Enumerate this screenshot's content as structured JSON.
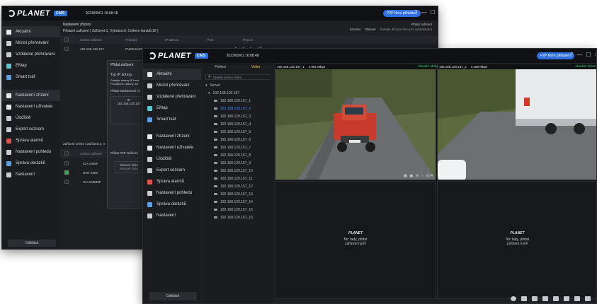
{
  "back_window": {
    "title_time": "2023/09/01 16:08:18",
    "p2p_label": "P2P Není přihlášen",
    "window_controls": [
      "?",
      "—",
      "☐",
      "✕"
    ],
    "nav": [
      {
        "label": "Aktuální",
        "icon": "camera-icon"
      },
      {
        "label": "Místní přehrávání",
        "icon": "list-icon"
      },
      {
        "label": "Vzdálené přehrávání",
        "icon": "wifi-icon"
      },
      {
        "label": "EMap",
        "icon": "map-icon"
      },
      {
        "label": "Smart tvář",
        "icon": "face-icon"
      },
      {
        "label": "Nastavení zřízení",
        "icon": "device-icon"
      },
      {
        "label": "Nastavení uživatele",
        "icon": "user-icon"
      },
      {
        "label": "Úložiště",
        "icon": "storage-icon"
      },
      {
        "label": "Export seznam",
        "icon": "export-icon"
      },
      {
        "label": "Správa alarmů",
        "icon": "alarm-icon"
      },
      {
        "label": "Nastavení pohledu",
        "icon": "view-icon"
      },
      {
        "label": "Správa obrázků",
        "icon": "image-icon"
      },
      {
        "label": "Nastavení",
        "icon": "settings-icon"
      }
    ],
    "logout_label": "Odhlásit",
    "content_title": "Nastavení zřízení",
    "added_devices": "Přidané zařízení  ( Zařízení:1, Vybráno:0, Celkem kanálů:16 )",
    "toolbar": {
      "delete": "Smazat",
      "refresh": "Obnovit",
      "add_device": "Přidat zařízení",
      "show_hint": "Zadejte díčova elmo pro vyhledávání"
    },
    "table_headers": [
      "Jméno zařízení",
      "Protokol",
      "IP adresa",
      "Port",
      "Provoz"
    ],
    "table_row": {
      "name": "192.168.120.157",
      "protocol": "PVMS,NVR",
      "ip": "192.168.120.157",
      "port": "80"
    },
    "dialog": {
      "title": "Přidat zařízení",
      "ip_type": "Typ IP adresy",
      "hint1": "Zadejte adresy IP hard",
      "hint2": "Použijeme zadaný adr",
      "hw_label": "Přidat hardwarové zř",
      "ip_col": "IP",
      "ip_val": "192.168.120.157",
      "p2p_label": "Přidat P2P zařízení",
      "serial": "Sériové číslo",
      "serial_sub": "Sériové číslo"
    },
    "online": {
      "header": "Zařízení online  ( Zařízení:3, V",
      "col": "Jméno zařízení",
      "rows": [
        {
          "name": "ICA-3460F",
          "checked": false
        },
        {
          "name": "NVR-1600",
          "checked": true
        },
        {
          "name": "ICA-M4580P",
          "checked": false
        }
      ]
    }
  },
  "front_window": {
    "title_time": "2023/09/01 16:08:48",
    "p2p_label": "P2P Není přihlášen",
    "window_controls": [
      "?",
      "—",
      "☐",
      "✕"
    ],
    "nav": [
      {
        "label": "Aktuální",
        "icon": "camera-icon"
      },
      {
        "label": "Místní přehrávání",
        "icon": "list-icon"
      },
      {
        "label": "Vzdálené přehrávání",
        "icon": "wifi-icon"
      },
      {
        "label": "EMap",
        "icon": "map-icon"
      },
      {
        "label": "Smart tvář",
        "icon": "face-icon"
      },
      {
        "label": "Nastavení zřízení",
        "icon": "device-icon"
      },
      {
        "label": "Nastavení uživatele",
        "icon": "user-icon"
      },
      {
        "label": "Úložiště",
        "icon": "storage-icon"
      },
      {
        "label": "Export seznam",
        "icon": "export-icon"
      },
      {
        "label": "Správa alarmů",
        "icon": "alarm-icon"
      },
      {
        "label": "Nastavení pohledu",
        "icon": "view-icon"
      },
      {
        "label": "Správa obrázků",
        "icon": "image-icon"
      },
      {
        "label": "Nastavení",
        "icon": "settings-icon"
      }
    ],
    "logout_label": "Odhlásit",
    "tabs": [
      "Pohled",
      "Video"
    ],
    "search_placeholder": "Zadejte jméno videa",
    "tree_root": "Server",
    "tree_device": "192.168.120.157",
    "channels": [
      "192.168.120.157_1",
      "192.168.120.157_2",
      "192.168.120.157_3",
      "192.168.120.157_4",
      "192.168.120.157_5",
      "192.168.120.157_6",
      "192.168.120.157_7",
      "192.168.120.157_8",
      "192.168.120.157_9",
      "192.168.120.157_10",
      "192.168.120.157_11",
      "192.168.120.157_12",
      "192.168.120.157_13",
      "192.168.120.157_14",
      "192.168.120.157_15",
      "192.168.120.157_16"
    ],
    "cells": [
      {
        "channel": "192.168.120.157_1",
        "rate": "1.961 Mbps",
        "status": "Aktuální obraz"
      },
      {
        "channel": "192.168.120.157_2",
        "rate": "4.185 Mbps",
        "status": "Aktuální obraz"
      }
    ],
    "cell_zoom": "x1/4",
    "empty_brand": "PLANET",
    "empty_text1": "Nic tady, přidat",
    "empty_text2": "zařízení nyní!",
    "colors": {
      "accent": "#2f6fe0",
      "live_green": "#3dd26b",
      "selected_blue": "#3e8cff",
      "bg": "#1e1f23"
    }
  }
}
